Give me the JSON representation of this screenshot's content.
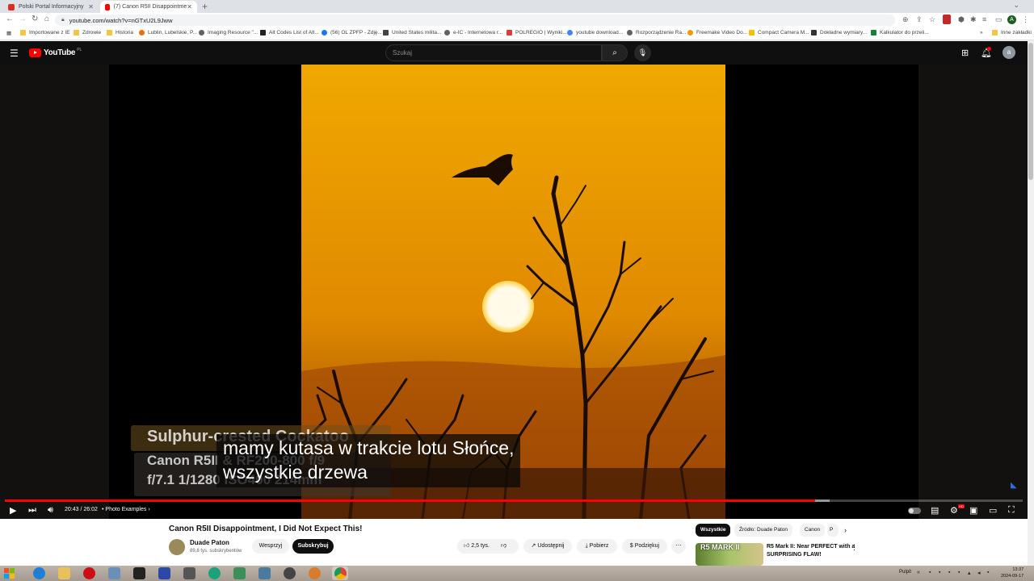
{
  "browser": {
    "tabs": [
      {
        "title": "Polski Portal Informacyjny",
        "favicon_color": "#d93025"
      },
      {
        "title": "(7) Canon R5II Disappointme",
        "favicon_color": "#ff0000"
      }
    ],
    "new_tab_symbol": "+",
    "url": "youtube.com/watch?v=nGTxU2L9Jww",
    "bookmarks": [
      {
        "label": "Importowane z IE",
        "icon_color": "#f4c542"
      },
      {
        "label": "Zdrowie",
        "icon_color": "#f4c542"
      },
      {
        "label": "Historia",
        "icon_color": "#f4c542"
      },
      {
        "label": "Lublin, Lubelskie, P...",
        "icon_color": "#e8710a"
      },
      {
        "label": "Imaging Resource \"...",
        "icon_color": "#5f6368"
      },
      {
        "label": "Alt Codes List of Alt...",
        "icon_color": "#202124"
      },
      {
        "label": "(56) OL ZPFP - Zdję...",
        "icon_color": "#1877f2"
      },
      {
        "label": "United States milita...",
        "icon_color": "#444"
      },
      {
        "label": "e-IC - Internetowa r...",
        "icon_color": "#5f6368"
      },
      {
        "label": "POLREGIO | Wyniki...",
        "icon_color": "#e53935"
      },
      {
        "label": "youtube download...",
        "icon_color": "#4285f4"
      },
      {
        "label": "Rozporządzenie Ra...",
        "icon_color": "#5f6368"
      },
      {
        "label": "Freemake Video Do...",
        "icon_color": "#f29900"
      },
      {
        "label": "Compact Camera M...",
        "icon_color": "#fbbc04"
      },
      {
        "label": "Dokładne wymiary...",
        "icon_color": "#333"
      },
      {
        "label": "Kalkulator do przeli...",
        "icon_color": "#188038"
      }
    ],
    "other_bookmarks": "Inne zakładki",
    "profile_initial": "A"
  },
  "youtube": {
    "logo_text": "YouTube",
    "region": "PL",
    "search_placeholder": "Szukaj",
    "avatar_initial": "a",
    "video": {
      "burned_in_title": "Sulphur-crested Cockatoo",
      "burned_in_line2": "Canon R5II & RF200-800 f/9",
      "burned_in_line3": "f/7.1 1/1280 ISO400 214mm",
      "subtitle_line1": "mamy kutasa  w trakcie lotu Słońce,",
      "subtitle_line2": "wszystkie drzewa",
      "sky_top": "#f0a800",
      "sky_bottom": "#8a3a05"
    },
    "controls": {
      "time": "20:43 / 26:02",
      "chapter": "• Photo Examples",
      "chapter_arrow": "›",
      "played_fraction": 0.796,
      "buffered_fraction": 0.81,
      "hd_badge": "HD"
    },
    "title": "Canon R5II Disappointment, I Did Not Expect This!",
    "channel": {
      "name": "Duade Paton",
      "subscribers": "89,8 tys. subskrybentów"
    },
    "buttons": {
      "support": "Wesprzyj",
      "subscribe": "Subskrybuj",
      "likes": "2,5 tys.",
      "share": "Udostępnij",
      "download": "Pobierz",
      "thanks": "Podziękuj",
      "more": "⋯"
    },
    "chips": [
      "Wszystkie",
      "Źródło: Duade Paton",
      "Canon",
      "P"
    ],
    "recommended": {
      "title": "R5 Mark II: Near PERFECT with a SURPRISING FLAW!",
      "thumb_text": "R5 MARK II"
    }
  },
  "taskbar": {
    "desktop_label": "Pulpit",
    "time": "13:37",
    "date": "2024-09-17"
  }
}
